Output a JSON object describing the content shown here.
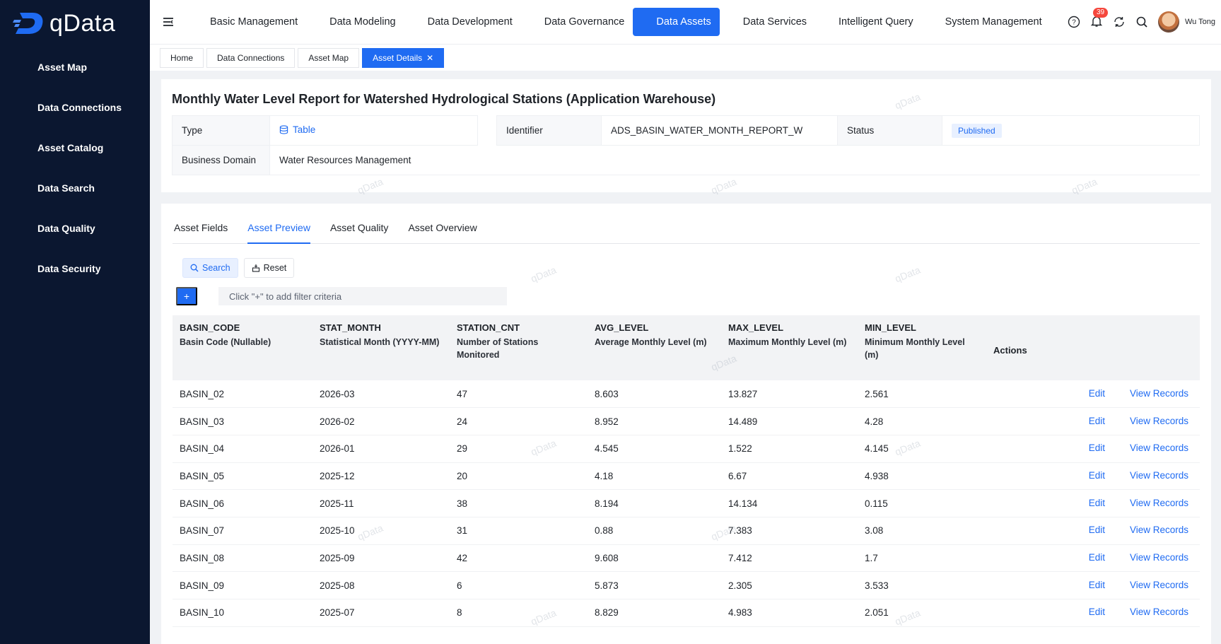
{
  "brand": {
    "name": "qData"
  },
  "sidebar": {
    "items": [
      {
        "label": "Asset Map",
        "icon": "map-icon",
        "has_chevron": false
      },
      {
        "label": "Data Connections",
        "icon": "connection-icon",
        "has_chevron": false
      },
      {
        "label": "Asset Catalog",
        "icon": "catalog-icon",
        "has_chevron": false
      },
      {
        "label": "Data Search",
        "icon": "search-icon",
        "has_chevron": false
      },
      {
        "label": "Data Quality",
        "icon": "quality-icon",
        "has_chevron": true
      },
      {
        "label": "Data Security",
        "icon": "shield-icon",
        "has_chevron": true
      }
    ]
  },
  "topnav": {
    "items": [
      {
        "label": "Basic Management",
        "icon": "building-icon"
      },
      {
        "label": "Data Modeling",
        "icon": "cube-icon"
      },
      {
        "label": "Data Development",
        "icon": "document-icon"
      },
      {
        "label": "Data Governance",
        "icon": "governance-icon"
      },
      {
        "label": "Data Assets",
        "icon": "assets-icon",
        "active": true
      },
      {
        "label": "Data Services",
        "icon": "hourglass-icon"
      },
      {
        "label": "Intelligent Query",
        "icon": "hexagon-icon"
      },
      {
        "label": "System Management",
        "icon": "settings-icon"
      }
    ],
    "notification_count": "39",
    "user_name": "Wu Tong"
  },
  "tabs": [
    {
      "label": "Home"
    },
    {
      "label": "Data Connections"
    },
    {
      "label": "Asset Map"
    },
    {
      "label": "Asset Details",
      "active": true
    }
  ],
  "asset": {
    "title": "Monthly Water Level Report for Watershed Hydrological Stations (Application Warehouse)",
    "type_label": "Type",
    "type_value": "Table",
    "identifier_label": "Identifier",
    "identifier_value": "ADS_BASIN_WATER_MONTH_REPORT_W",
    "status_label": "Status",
    "status_value": "Published",
    "domain_label": "Business Domain",
    "domain_value": "Water Resources Management"
  },
  "subtabs": [
    {
      "label": "Asset Fields"
    },
    {
      "label": "Asset Preview",
      "active": true
    },
    {
      "label": "Asset Quality"
    },
    {
      "label": "Asset Overview"
    }
  ],
  "toolbar": {
    "search_label": "Search",
    "reset_label": "Reset",
    "add_label": "+",
    "filter_placeholder": "Click \"+\" to add filter criteria"
  },
  "table": {
    "columns": [
      {
        "code": "BASIN_CODE",
        "desc": "Basin Code (Nullable)"
      },
      {
        "code": "STAT_MONTH",
        "desc": "Statistical Month (YYYY-MM)"
      },
      {
        "code": "STATION_CNT",
        "desc": "Number of Stations Monitored"
      },
      {
        "code": "AVG_LEVEL",
        "desc": "Average Monthly Level (m)"
      },
      {
        "code": "MAX_LEVEL",
        "desc": "Maximum Monthly Level (m)"
      },
      {
        "code": "MIN_LEVEL",
        "desc": "Minimum Monthly Level (m)"
      }
    ],
    "actions_header": "Actions",
    "edit_label": "Edit",
    "view_label": "View Records",
    "rows": [
      [
        "BASIN_02",
        "2026-03",
        "47",
        "8.603",
        "13.827",
        "2.561"
      ],
      [
        "BASIN_03",
        "2026-02",
        "24",
        "8.952",
        "14.489",
        "4.28"
      ],
      [
        "BASIN_04",
        "2026-01",
        "29",
        "4.545",
        "1.522",
        "4.145"
      ],
      [
        "BASIN_05",
        "2025-12",
        "20",
        "4.18",
        "6.67",
        "4.938"
      ],
      [
        "BASIN_06",
        "2025-11",
        "38",
        "8.194",
        "14.134",
        "0.115"
      ],
      [
        "BASIN_07",
        "2025-10",
        "31",
        "0.88",
        "7.383",
        "3.08"
      ],
      [
        "BASIN_08",
        "2025-09",
        "42",
        "9.608",
        "7.412",
        "1.7"
      ],
      [
        "BASIN_09",
        "2025-08",
        "6",
        "5.873",
        "2.305",
        "3.533"
      ],
      [
        "BASIN_10",
        "2025-07",
        "8",
        "8.829",
        "4.983",
        "2.051"
      ]
    ]
  },
  "watermark_text": "qData",
  "colors": {
    "accent": "#1f6bf2",
    "sidebar": "#0b1730",
    "badge": "#f5473d"
  }
}
